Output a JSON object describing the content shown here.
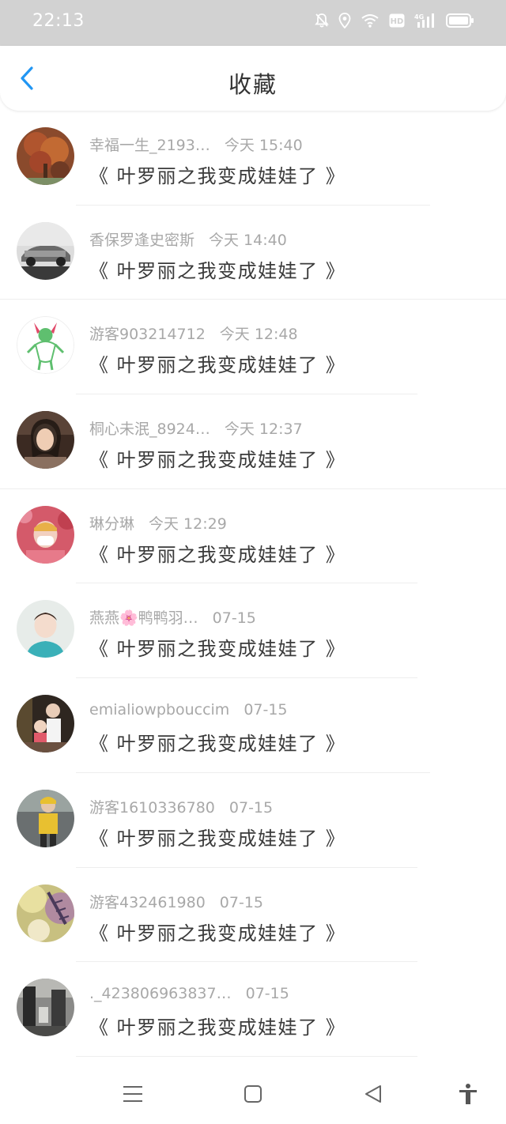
{
  "status_bar": {
    "time": "22:13",
    "icons": [
      "mute-bell-icon",
      "location-icon",
      "wifi-icon",
      "hd-icon",
      "4g-signal-icon",
      "battery-icon"
    ],
    "hd_label": "HD",
    "network_label": "4G"
  },
  "header": {
    "title": "收藏",
    "back_icon": "chevron-left-icon",
    "accent_color": "#2196f3"
  },
  "favorites": [
    {
      "user": "幸福一生_2193…",
      "time": "今天 15:40",
      "title": "《 叶罗丽之我变成娃娃了 》"
    },
    {
      "user": "香保罗逢史密斯",
      "time": "今天 14:40",
      "title": "《 叶罗丽之我变成娃娃了 》"
    },
    {
      "user": "游客903214712",
      "time": "今天 12:48",
      "title": "《 叶罗丽之我变成娃娃了 》"
    },
    {
      "user": "桐心未泯_8924…",
      "time": "今天 12:37",
      "title": "《 叶罗丽之我变成娃娃了 》"
    },
    {
      "user": "琳分琳",
      "time": "今天 12:29",
      "title": "《 叶罗丽之我变成娃娃了 》"
    },
    {
      "user": "燕燕🌸鸭鸭羽…",
      "time": "07-15",
      "title": "《 叶罗丽之我变成娃娃了 》"
    },
    {
      "user": "emialiowpbouccim",
      "time": "07-15",
      "title": "《 叶罗丽之我变成娃娃了 》"
    },
    {
      "user": "游客1610336780",
      "time": "07-15",
      "title": "《 叶罗丽之我变成娃娃了 》"
    },
    {
      "user": "游客432461980",
      "time": "07-15",
      "title": "《 叶罗丽之我变成娃娃了 》"
    },
    {
      "user": "._423806963837…",
      "time": "07-15",
      "title": "《 叶罗丽之我变成娃娃了 》"
    }
  ],
  "nav_bar": {
    "icons": [
      "menu-icon",
      "home-square-icon",
      "back-triangle-icon",
      "accessibility-icon"
    ]
  }
}
